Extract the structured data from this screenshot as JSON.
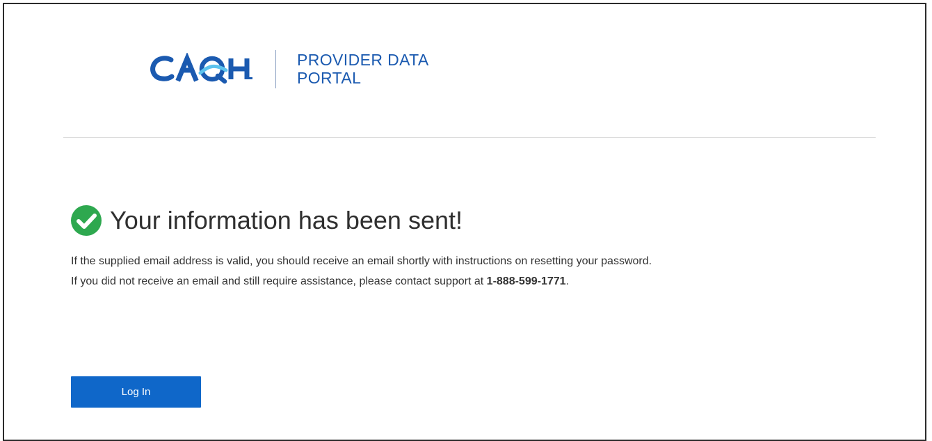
{
  "header": {
    "logo_text": "CAQH",
    "portal_name_line1": "PROVIDER DATA",
    "portal_name_line2": "PORTAL"
  },
  "confirmation": {
    "icon": "check-circle-icon",
    "title": "Your information has been sent!",
    "line1": "If the supplied email address is valid, you should receive an email shortly with instructions on resetting your password.",
    "line2_prefix": "If you did not receive an email and still require assistance, please contact support at ",
    "phone": "1-888-599-1771",
    "line2_suffix": "."
  },
  "actions": {
    "login_label": "Log In"
  },
  "colors": {
    "brand_blue": "#1b5ab0",
    "button_blue": "#0f67c9",
    "success_green": "#2ea84f",
    "logo_light_blue": "#5cc3ee"
  }
}
